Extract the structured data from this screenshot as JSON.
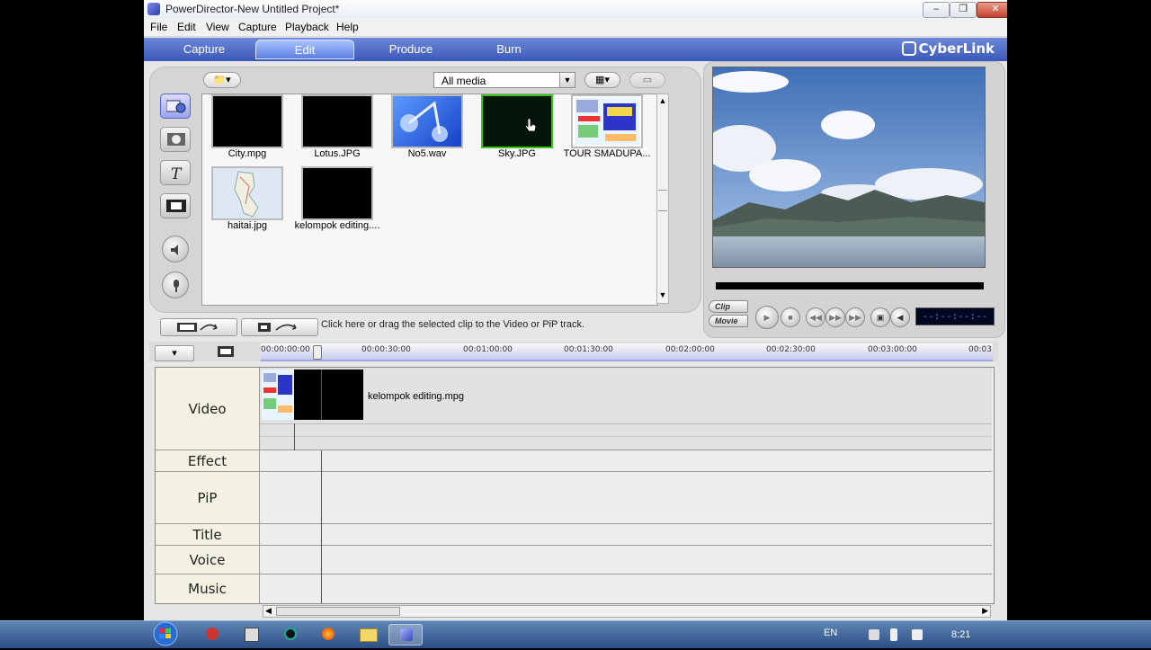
{
  "window": {
    "title": "PowerDirector-New Untitled Project*"
  },
  "menu": [
    "File",
    "Edit",
    "View",
    "Capture",
    "Playback",
    "Help"
  ],
  "tabs": [
    "Capture",
    "Edit",
    "Produce",
    "Burn"
  ],
  "active_tab": "Edit",
  "brand": "CyberLink",
  "library": {
    "filter": "All media",
    "items": [
      {
        "label": "City.mpg",
        "kind": "video"
      },
      {
        "label": "Lotus.JPG",
        "kind": "image"
      },
      {
        "label": "No5.wav",
        "kind": "audio"
      },
      {
        "label": "Sky.JPG",
        "kind": "image",
        "selected": true
      },
      {
        "label": "TOUR SMADUPA...",
        "kind": "image"
      },
      {
        "label": "haitai.jpg",
        "kind": "image"
      },
      {
        "label": "kelompok editing....",
        "kind": "video"
      }
    ]
  },
  "hint": "Click here or drag the selected clip to the Video or PiP track.",
  "preview": {
    "clip_label": "Clip",
    "movie_label": "Movie",
    "timecode": "--:--:--:--"
  },
  "timeline": {
    "ticks": [
      "00:00:00:00",
      "00:00:30:00",
      "00:01:00:00",
      "00:01:30:00",
      "00:02:00:00",
      "00:02:30:00",
      "00:03:00:00",
      "00:03"
    ],
    "tracks": [
      "Video",
      "Effect",
      "PiP",
      "Title",
      "Voice",
      "Music"
    ],
    "video_clip_label": "kelompok editing.mpg"
  },
  "taskbar": {
    "language": "EN",
    "clock": "8:21"
  },
  "colors": {
    "tab_bar": "#3b58b8",
    "selected_border": "#39c51a",
    "timecode_fg": "#4f7cff"
  }
}
